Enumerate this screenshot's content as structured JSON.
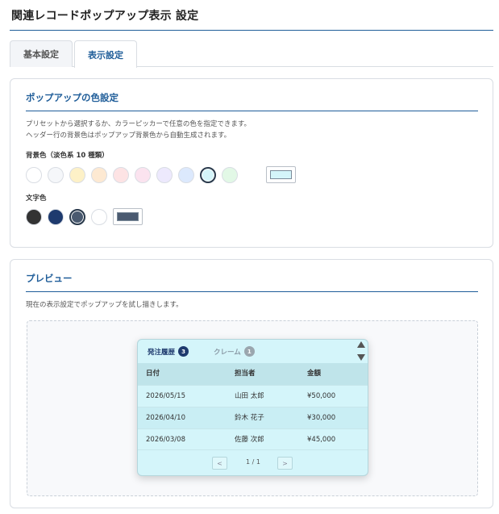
{
  "header": {
    "title": "関連レコードポップアップ表示 設定"
  },
  "tabs": [
    {
      "label": "基本設定",
      "active": false
    },
    {
      "label": "表示設定",
      "active": true
    }
  ],
  "color_settings": {
    "heading": "ポップアップの色設定",
    "desc_line1": "プリセットから選択するか、カラーピッカーで任意の色を指定できます。",
    "desc_line2": "ヘッダー行の背景色はポップアップ背景色から自動生成されます。",
    "bg_label": "背景色（淡色系 10 種類）",
    "bg_swatches": [
      "#ffffff",
      "#f5f7fa",
      "#fdf1c7",
      "#fde9d2",
      "#fde3e4",
      "#fbe3ef",
      "#ede9fd",
      "#dce9fd",
      "#d4f5fa",
      "#e2f8e6"
    ],
    "bg_selected_index": 8,
    "bg_picker_color": "#d4f5fa",
    "text_label": "文字色",
    "text_swatches": [
      "#333333",
      "#1e3a6e",
      "#4a5a70",
      "#ffffff"
    ],
    "text_selected_index": 2,
    "text_picker_color": "#4a5a70"
  },
  "preview": {
    "heading": "プレビュー",
    "desc": "現在の表示設定でポップアップを試し描きします。",
    "popup": {
      "tabs": [
        {
          "label": "発注履歴",
          "count": "3",
          "active": true
        },
        {
          "label": "クレーム",
          "count": "1",
          "active": false
        }
      ],
      "columns": [
        "日付",
        "担当者",
        "金額"
      ],
      "rows": [
        [
          "2026/05/15",
          "山田 太郎",
          "¥50,000"
        ],
        [
          "2026/04/10",
          "鈴木 花子",
          "¥30,000"
        ],
        [
          "2026/03/08",
          "佐藤 次郎",
          "¥45,000"
        ]
      ],
      "pager": {
        "prev": "<",
        "info": "1 / 1",
        "next": ">"
      }
    }
  }
}
